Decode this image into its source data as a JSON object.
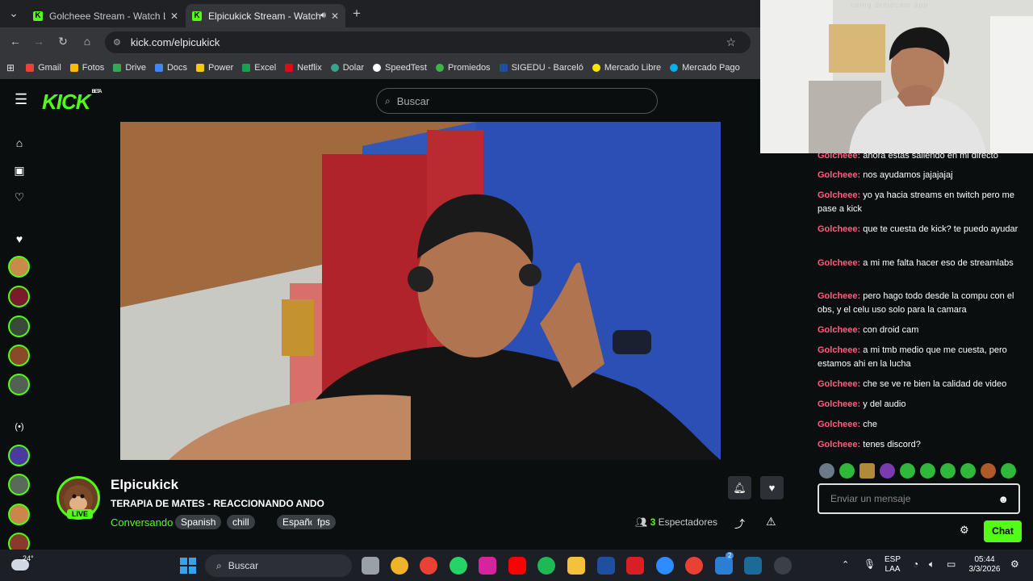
{
  "browser": {
    "tabs": [
      {
        "title": "Golcheee Stream - Watch Live o"
      },
      {
        "title": "Elpicukick Stream - Watch L"
      }
    ],
    "url": "kick.com/elpicukick",
    "bookmarks": [
      "Gmail",
      "Fotos",
      "Drive",
      "Docs",
      "Power",
      "Excel",
      "Netflix",
      "Dolar",
      "SpeedTest",
      "Promiedos",
      "SIGEDU - Barceló",
      "Mercado Libre",
      "Mercado Pago"
    ]
  },
  "header": {
    "logo": "KICK",
    "logo_badge": "BETA",
    "search_placeholder": "Buscar"
  },
  "channel": {
    "name": "Elpicukick",
    "live_label": "LIVE",
    "title": "TERAPIA DE MATES - REACCIONANDO ANDO",
    "category": "Conversando",
    "tags": [
      "Spanish",
      "chill",
      "Español",
      "fps"
    ],
    "viewers_count": "3",
    "viewers_label": "Espectadores"
  },
  "chat": {
    "messages": [
      {
        "user": "Golcheee",
        "text": "ahora estás saliendo en mi directo"
      },
      {
        "user": "Golcheee",
        "text": "nos ayudamos jajajajaj"
      },
      {
        "user": "Golcheee",
        "text": "yo ya hacia streams en twitch pero me pase a kick"
      },
      {
        "user": "Golcheee",
        "text": "que te cuesta de kick? te puedo ayudar"
      },
      {
        "user": "Golcheee",
        "text": "a mi me falta hacer eso de streamlabs"
      },
      {
        "user": "Golcheee",
        "text": "pero hago todo desde la compu con el obs, y el celu uso solo para la camara"
      },
      {
        "user": "Golcheee",
        "text": "con droid cam"
      },
      {
        "user": "Golcheee",
        "text": "a mi tmb medio que me cuesta, pero estamos ahi en la lucha"
      },
      {
        "user": "Golcheee",
        "text": "che se ve re bien la calidad de video"
      },
      {
        "user": "Golcheee",
        "text": "y del audio"
      },
      {
        "user": "Golcheee",
        "text": "che"
      },
      {
        "user": "Golcheee",
        "text": "tenes discord?"
      }
    ],
    "input_placeholder": "Enviar un mensaje",
    "send_label": "Chat"
  },
  "webcam_overlay_text": "using droidcam app",
  "taskbar": {
    "search_placeholder": "Buscar",
    "weather": "24°",
    "lang_top": "ESP",
    "lang_bottom": "LAA",
    "time": "05:44",
    "date": "3/3/2026",
    "badge": "2"
  },
  "colors": {
    "accent": "#53fc18",
    "chat_user": "#ff5d82",
    "background": "#0b0e0f"
  }
}
